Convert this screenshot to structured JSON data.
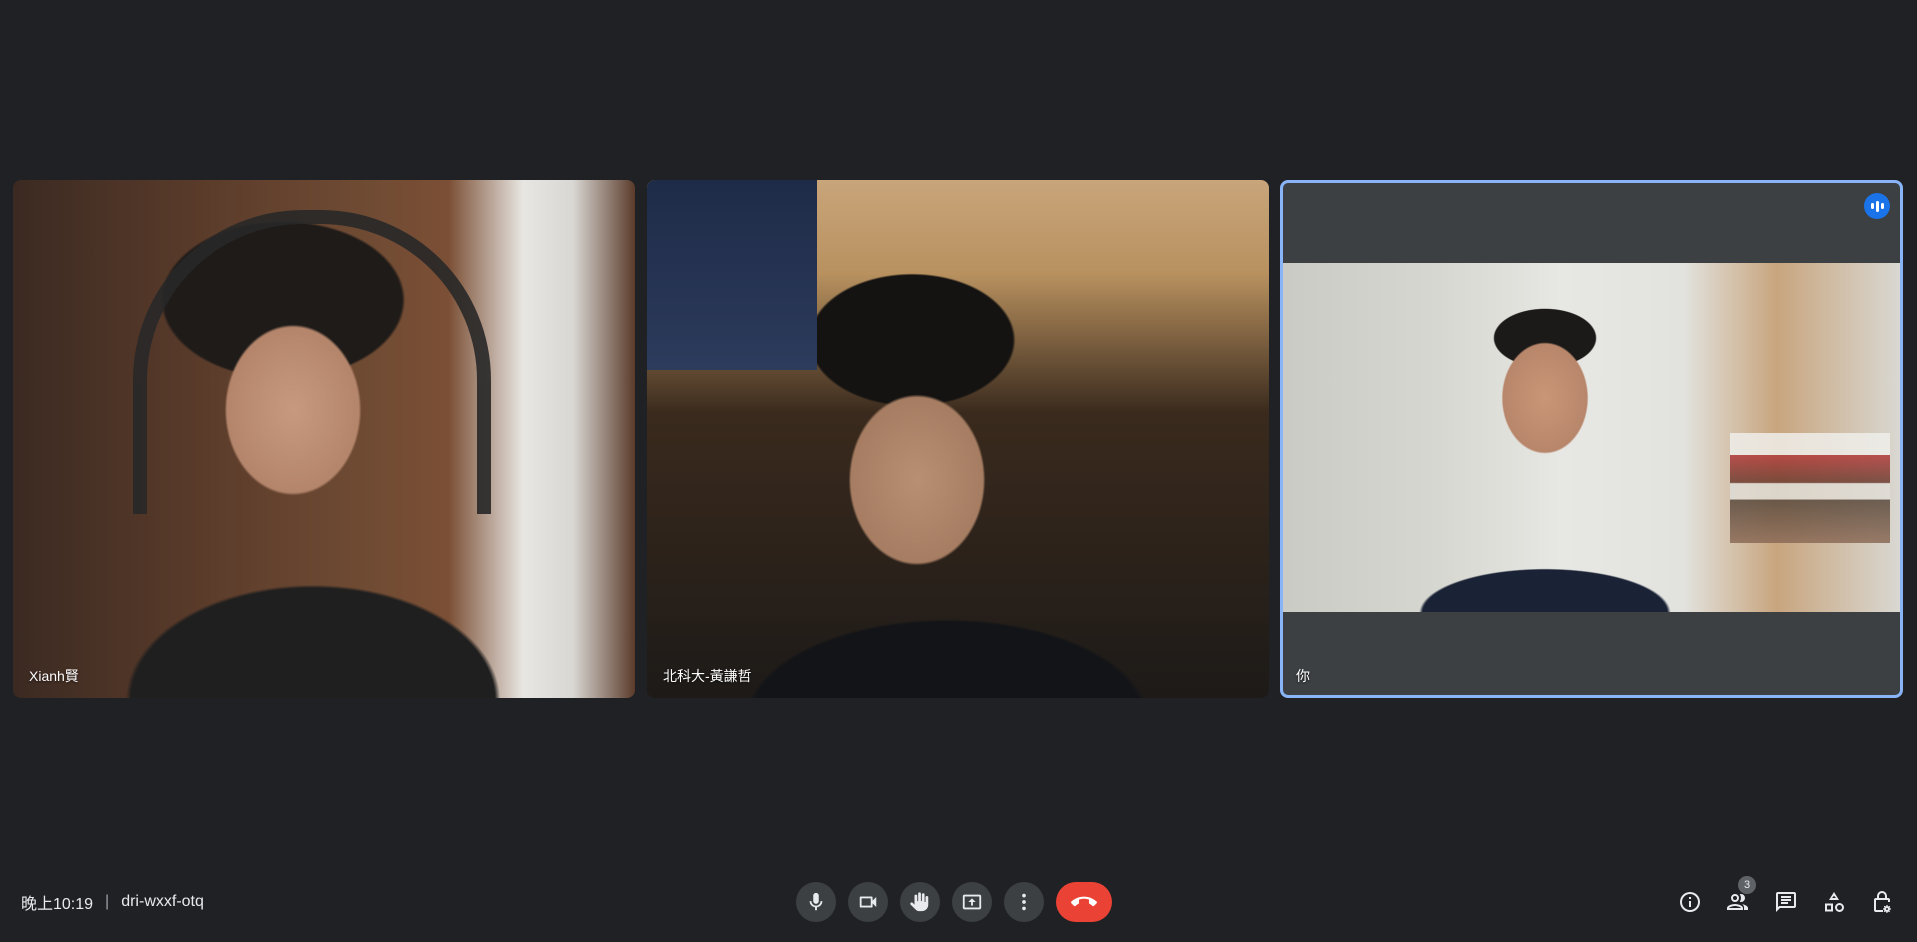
{
  "participants": [
    {
      "name": "Xianh賢"
    },
    {
      "name": "北科大-黃謙哲"
    },
    {
      "name": "你"
    }
  ],
  "meeting": {
    "time": "晚上10:19",
    "separator": "|",
    "code": "dri-wxxf-otq"
  },
  "controls": {
    "mic": "microphone-icon",
    "camera": "camera-icon",
    "hand": "raise-hand-icon",
    "present": "present-screen-icon",
    "more": "more-options-icon",
    "end": "end-call-icon"
  },
  "tools": {
    "info": "info-icon",
    "people": "people-icon",
    "people_count": "3",
    "chat": "chat-icon",
    "activities": "activities-icon",
    "host_controls": "host-controls-icon"
  },
  "colors": {
    "background": "#202124",
    "button": "#3c4043",
    "end_call": "#ea4335",
    "active_border": "#8ab4f8",
    "speaking": "#1a73e8"
  }
}
